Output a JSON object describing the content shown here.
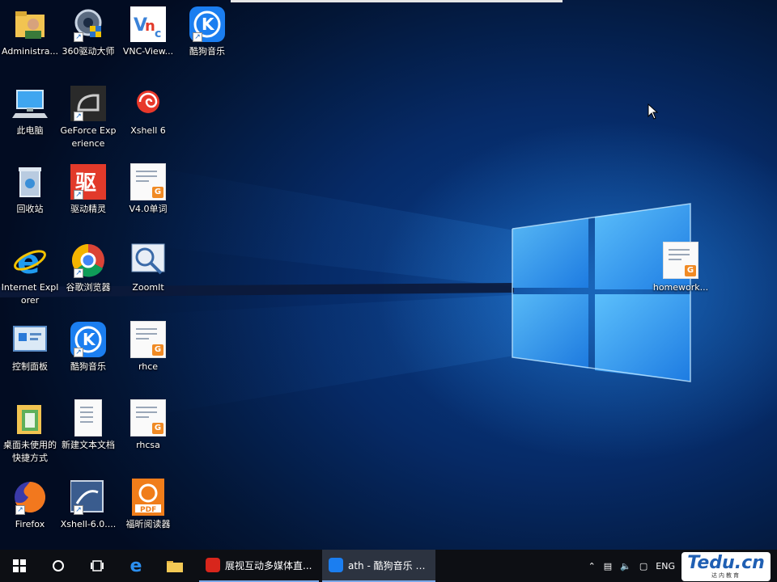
{
  "desktop": {
    "icons": [
      {
        "label": "Administra...",
        "icon": "user-folder-icon"
      },
      {
        "label": "360驱动大师",
        "icon": "gear-shield-icon"
      },
      {
        "label": "VNC-View...",
        "icon": "vnc-icon"
      },
      {
        "label": "酷狗音乐",
        "icon": "kugou-icon"
      },
      {
        "label": "此电脑",
        "icon": "computer-icon"
      },
      {
        "label": "GeForce Experience",
        "icon": "nvidia-icon"
      },
      {
        "label": "Xshell 6",
        "icon": "xshell-icon"
      },
      {
        "label": "回收站",
        "icon": "recycle-bin-icon"
      },
      {
        "label": "驱动精灵",
        "icon": "driver-genius-icon"
      },
      {
        "label": "V4.0单词",
        "icon": "document-icon"
      },
      {
        "label": "Internet Explorer",
        "icon": "ie-icon"
      },
      {
        "label": "谷歌浏览器",
        "icon": "chrome-icon"
      },
      {
        "label": "ZoomIt",
        "icon": "zoomit-icon"
      },
      {
        "label": "控制面板",
        "icon": "control-panel-icon"
      },
      {
        "label": "酷狗音乐",
        "icon": "kugou-icon"
      },
      {
        "label": "rhce",
        "icon": "document-icon"
      },
      {
        "label": "桌面未使用的快捷方式",
        "icon": "folder-icon"
      },
      {
        "label": "新建文本文档",
        "icon": "text-file-icon"
      },
      {
        "label": "rhcsa",
        "icon": "document-icon"
      },
      {
        "label": "Firefox",
        "icon": "firefox-icon"
      },
      {
        "label": "Xshell-6.0....",
        "icon": "xshell-setup-icon"
      },
      {
        "label": "福昕阅读器",
        "icon": "foxit-icon"
      },
      {
        "label": "homework...",
        "icon": "document-icon"
      }
    ]
  },
  "taskbar": {
    "apps": [
      {
        "label": "展视互动多媒体直...",
        "icon": "live-icon"
      },
      {
        "label": "ath - 酷狗音乐 Kel...",
        "icon": "kugou-icon"
      }
    ],
    "tray": {
      "lang": "ENG"
    }
  },
  "watermark": {
    "main": "Tedu.cn",
    "sub": "达内教育"
  },
  "colors": {
    "accent": "#1a8cff",
    "taskbar": "#0d0f14"
  }
}
